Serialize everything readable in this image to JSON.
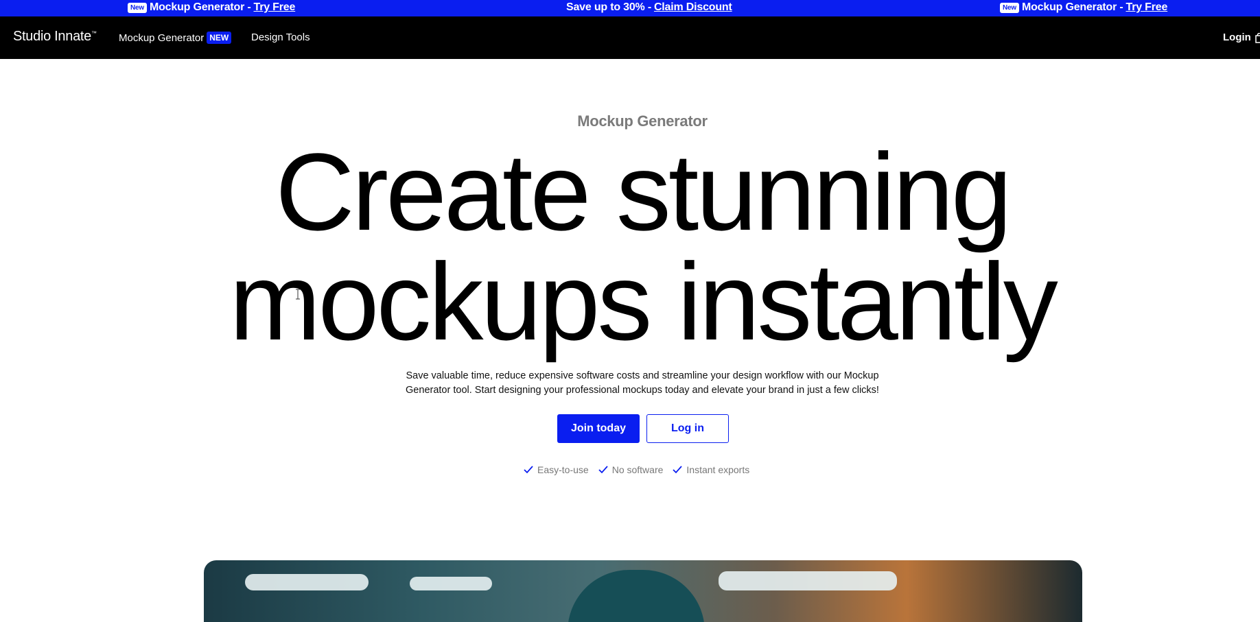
{
  "announcement": {
    "left": {
      "badge": "New",
      "text": "Mockup Generator - ",
      "link": "Try Free"
    },
    "center": {
      "text": "Save up to 30% - ",
      "link": "Claim Discount"
    },
    "right": {
      "badge": "New",
      "text": "Mockup Generator - ",
      "link": "Try Free"
    }
  },
  "nav": {
    "logo": "Studio Innate",
    "logo_mark": "™",
    "links": [
      {
        "label": "Mockup Generator",
        "badge": "NEW"
      },
      {
        "label": "Design Tools"
      }
    ],
    "login": "Login",
    "cart_icon": "shopping-bag-icon"
  },
  "hero": {
    "eyebrow": "Mockup Generator",
    "headline_line1": "Create stunning",
    "headline_line2": "mockups instantly",
    "subcopy": "Save valuable time, reduce expensive software costs and streamline your design workflow with our Mockup Generator tool. Start designing your professional mockups today and elevate your brand in just a few clicks!",
    "primary_button": "Join today",
    "secondary_button": "Log in",
    "features": [
      "Easy-to-use",
      "No software",
      "Instant exports"
    ]
  },
  "colors": {
    "brand_blue": "#0a1ef0",
    "nav_bg": "#000000"
  }
}
